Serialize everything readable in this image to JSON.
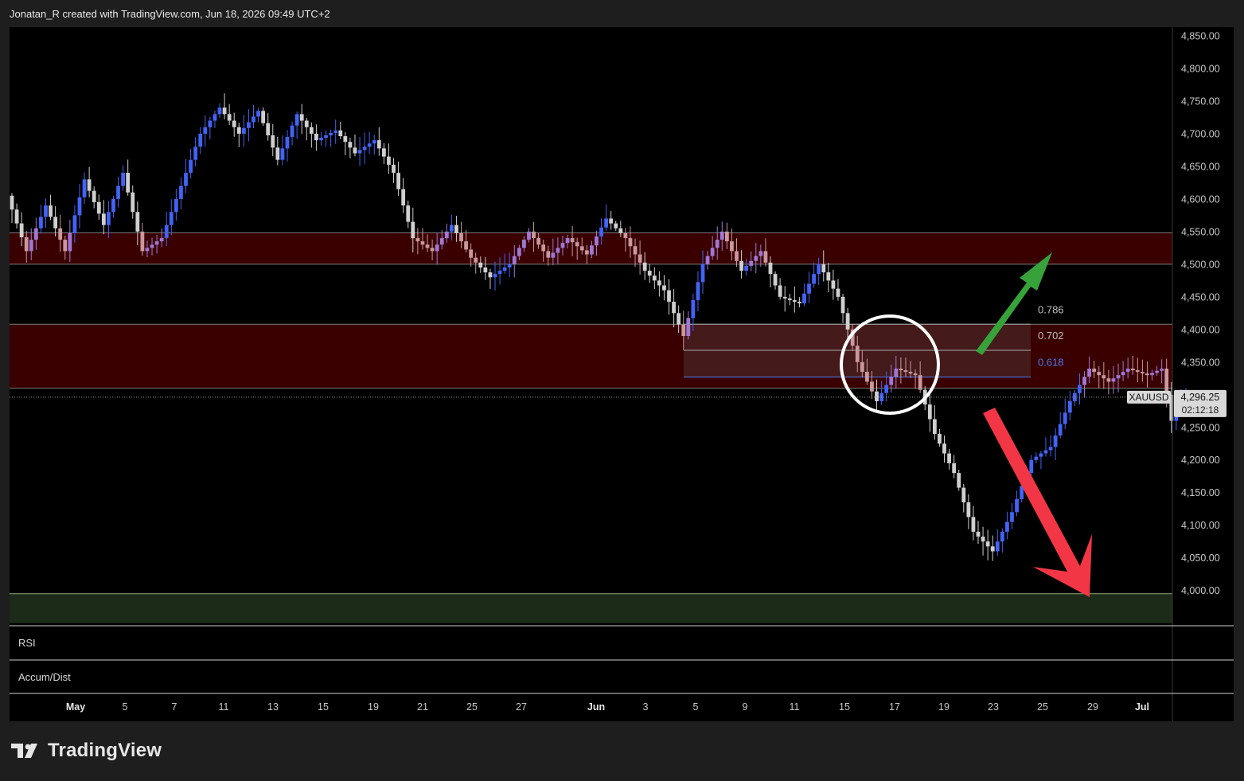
{
  "header": {
    "attribution": "Jonatan_R created with TradingView.com, Jun 18, 2026 09:49 UTC+2"
  },
  "footer": {
    "brand": "TradingView"
  },
  "colors": {
    "bull": "#4263f5",
    "bear": "#cfcfcf",
    "bull_in_zone": "#a077d6",
    "bear_in_zone": "#c9979d",
    "resistance_zone": "#3a0000",
    "support_zone": "#1c2b18",
    "arrow_up": "#37a23a",
    "arrow_down": "#f23645",
    "fib_618": "#4a7cf0"
  },
  "chart_data": {
    "type": "candlestick",
    "symbol": "XAUUSD",
    "last_price": "4,296.25",
    "countdown": "02:12:18",
    "last_price_value": 4296.25,
    "y_axis": {
      "range": [
        3955,
        4875
      ],
      "ticks": [
        {
          "value": 4850,
          "label": "4,850.00"
        },
        {
          "value": 4800,
          "label": "4,800.00"
        },
        {
          "value": 4750,
          "label": "4,750.00"
        },
        {
          "value": 4700,
          "label": "4,700.00"
        },
        {
          "value": 4650,
          "label": "4,650.00"
        },
        {
          "value": 4600,
          "label": "4,600.00"
        },
        {
          "value": 4550,
          "label": "4,550.00"
        },
        {
          "value": 4500,
          "label": "4,500.00"
        },
        {
          "value": 4450,
          "label": "4,450.00"
        },
        {
          "value": 4400,
          "label": "4,400.00"
        },
        {
          "value": 4350,
          "label": "4,350.00"
        },
        {
          "value": 4250,
          "label": "4,250.00"
        },
        {
          "value": 4200,
          "label": "4,200.00"
        },
        {
          "value": 4150,
          "label": "4,150.00"
        },
        {
          "value": 4100,
          "label": "4,100.00"
        },
        {
          "value": 4050,
          "label": "4,050.00"
        },
        {
          "value": 4000,
          "label": "4,000.00"
        }
      ]
    },
    "x_axis": {
      "ticks": [
        {
          "label": "May",
          "strong": true
        },
        {
          "label": "5"
        },
        {
          "label": "7"
        },
        {
          "label": "11"
        },
        {
          "label": "13"
        },
        {
          "label": "15"
        },
        {
          "label": "19"
        },
        {
          "label": "21"
        },
        {
          "label": "25"
        },
        {
          "label": "27"
        },
        {
          "label": "Jun",
          "strong": true
        },
        {
          "label": "3"
        },
        {
          "label": "5"
        },
        {
          "label": "9"
        },
        {
          "label": "11"
        },
        {
          "label": "15"
        },
        {
          "label": "17"
        },
        {
          "label": "19"
        },
        {
          "label": "23"
        },
        {
          "label": "25"
        },
        {
          "label": "29"
        },
        {
          "label": "Jul",
          "strong": true
        }
      ]
    },
    "zones": [
      {
        "name": "upper-resistance",
        "from": 4500,
        "to": 4548
      },
      {
        "name": "lower-resistance",
        "from": 4310,
        "to": 4408
      },
      {
        "name": "support",
        "from": 3950,
        "to": 3995
      }
    ],
    "fib_levels": [
      {
        "label": "0.786",
        "value": 4408
      },
      {
        "label": "0.702",
        "value": 4368
      },
      {
        "label": "0.618",
        "value": 4327
      }
    ],
    "anchors": [
      {
        "t": 0,
        "p": 4605
      },
      {
        "t": 4,
        "p": 4520
      },
      {
        "t": 8,
        "p": 4590
      },
      {
        "t": 12,
        "p": 4520
      },
      {
        "t": 16,
        "p": 4630
      },
      {
        "t": 20,
        "p": 4560
      },
      {
        "t": 24,
        "p": 4640
      },
      {
        "t": 28,
        "p": 4520
      },
      {
        "t": 32,
        "p": 4540
      },
      {
        "t": 36,
        "p": 4620
      },
      {
        "t": 40,
        "p": 4700
      },
      {
        "t": 44,
        "p": 4740
      },
      {
        "t": 48,
        "p": 4700
      },
      {
        "t": 52,
        "p": 4735
      },
      {
        "t": 56,
        "p": 4660
      },
      {
        "t": 60,
        "p": 4730
      },
      {
        "t": 64,
        "p": 4690
      },
      {
        "t": 68,
        "p": 4705
      },
      {
        "t": 72,
        "p": 4670
      },
      {
        "t": 76,
        "p": 4690
      },
      {
        "t": 80,
        "p": 4640
      },
      {
        "t": 84,
        "p": 4540
      },
      {
        "t": 88,
        "p": 4520
      },
      {
        "t": 92,
        "p": 4560
      },
      {
        "t": 96,
        "p": 4510
      },
      {
        "t": 100,
        "p": 4480
      },
      {
        "t": 104,
        "p": 4500
      },
      {
        "t": 108,
        "p": 4550
      },
      {
        "t": 112,
        "p": 4510
      },
      {
        "t": 116,
        "p": 4540
      },
      {
        "t": 120,
        "p": 4515
      },
      {
        "t": 124,
        "p": 4570
      },
      {
        "t": 128,
        "p": 4540
      },
      {
        "t": 132,
        "p": 4490
      },
      {
        "t": 136,
        "p": 4460
      },
      {
        "t": 140,
        "p": 4390
      },
      {
        "t": 144,
        "p": 4500
      },
      {
        "t": 148,
        "p": 4550
      },
      {
        "t": 152,
        "p": 4490
      },
      {
        "t": 156,
        "p": 4520
      },
      {
        "t": 160,
        "p": 4450
      },
      {
        "t": 164,
        "p": 4440
      },
      {
        "t": 168,
        "p": 4500
      },
      {
        "t": 172,
        "p": 4450
      },
      {
        "t": 176,
        "p": 4350
      },
      {
        "t": 180,
        "p": 4290
      },
      {
        "t": 184,
        "p": 4340
      },
      {
        "t": 188,
        "p": 4330
      },
      {
        "t": 192,
        "p": 4240
      },
      {
        "t": 196,
        "p": 4180
      },
      {
        "t": 200,
        "p": 4090
      },
      {
        "t": 204,
        "p": 4060
      },
      {
        "t": 208,
        "p": 4120
      },
      {
        "t": 212,
        "p": 4200
      },
      {
        "t": 216,
        "p": 4220
      },
      {
        "t": 220,
        "p": 4290
      },
      {
        "t": 224,
        "p": 4340
      },
      {
        "t": 228,
        "p": 4320
      },
      {
        "t": 232,
        "p": 4340
      },
      {
        "t": 236,
        "p": 4330
      },
      {
        "t": 239,
        "p": 4340
      },
      {
        "t": 241,
        "p": 4260
      },
      {
        "t": 243,
        "p": 4296
      }
    ],
    "series": [
      {
        "type": "candlestick",
        "values": "generated from anchors"
      }
    ]
  },
  "panes": {
    "rsi_label": "RSI",
    "accum_label": "Accum/Dist"
  }
}
